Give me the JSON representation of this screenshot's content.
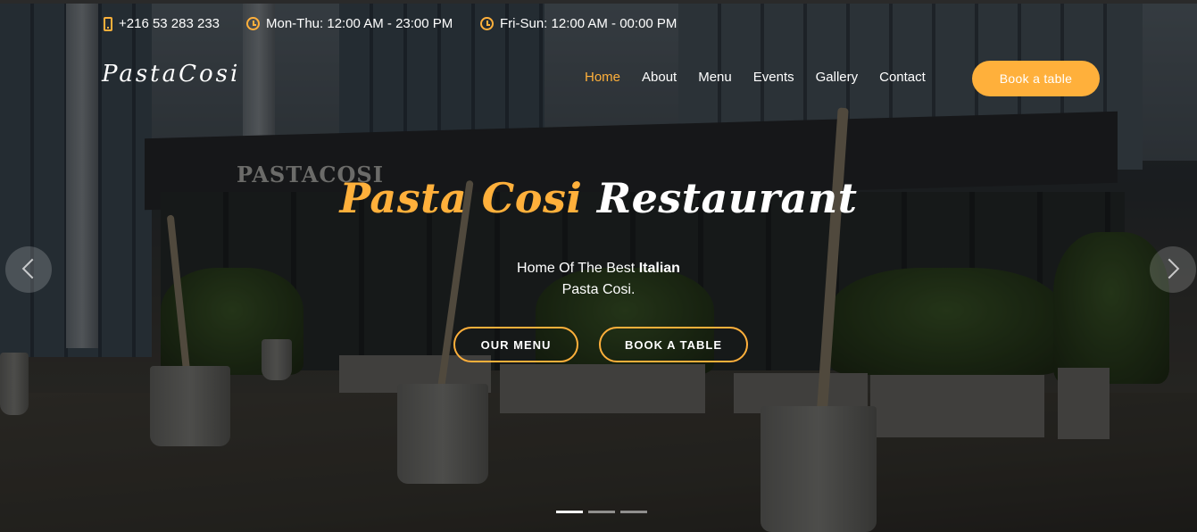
{
  "topbar": {
    "phone": "+216 53 283 233",
    "hours_weekday": "Mon-Thu: 12:00 AM - 23:00 PM",
    "hours_weekend": "Fri-Sun: 12:00 AM - 00:00 PM",
    "icons": [
      "phone-icon",
      "clock-icon",
      "clock-icon"
    ]
  },
  "header": {
    "logo": "PastaCosi",
    "nav": [
      {
        "label": "Home",
        "active": true
      },
      {
        "label": "About",
        "active": false
      },
      {
        "label": "Menu",
        "active": false
      },
      {
        "label": "Events",
        "active": false
      },
      {
        "label": "Gallery",
        "active": false
      },
      {
        "label": "Contact",
        "active": false
      }
    ],
    "book_button": "Book a table"
  },
  "hero": {
    "title_accent": "Pasta Cosi",
    "title_rest": "Restaurant",
    "subtitle_line1_pre": "Home Of The Best ",
    "subtitle_line1_bold": "Italian",
    "subtitle_line2": "Pasta Cosi.",
    "cta_menu": "OUR MENU",
    "cta_book": "BOOK A TABLE",
    "sign_text": "PASTACOSI"
  },
  "carousel": {
    "slide_count": 3,
    "active_slide": 1
  },
  "colors": {
    "accent": "#ffb03b",
    "text": "#ffffff"
  }
}
